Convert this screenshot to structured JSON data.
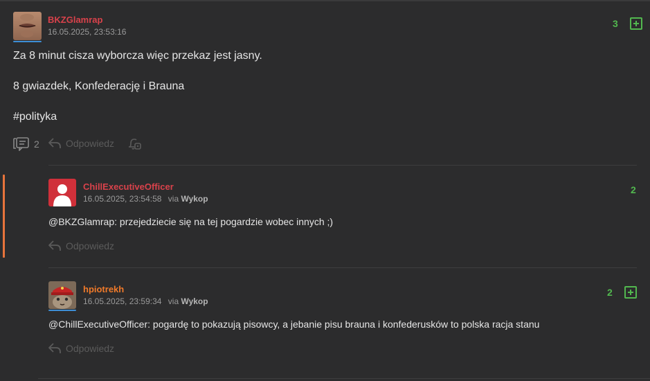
{
  "entry": {
    "author": "BKZGlamrap",
    "timestamp": "16.05.2025, 23:53:16",
    "votes": "3",
    "lines": [
      "Za 8 minut cisza wyborcza więc przekaz jest jasny.",
      "8 gwiazdek, Konfederację i Brauna",
      "#polityka"
    ],
    "comments_count": "2",
    "reply_label": "Odpowiedz"
  },
  "comments": [
    {
      "author": "ChillExecutiveOfficer",
      "timestamp": "16.05.2025, 23:54:58",
      "via_prefix": "via",
      "via_app": "Wykop",
      "votes": "2",
      "mention": "@BKZGlamrap",
      "text": ": przejedziecie się na tej pogardzie wobec innych ;)",
      "reply_label": "Odpowiedz"
    },
    {
      "author": "hpiotrekh",
      "timestamp": "16.05.2025, 23:59:34",
      "via_prefix": "via",
      "via_app": "Wykop",
      "votes": "2",
      "mention": "@ChillExecutiveOfficer",
      "text": ": pogardę to pokazują pisowcy, a jebanie pisu brauna i konfederusków to polska racja stanu",
      "reply_label": "Odpowiedz"
    }
  ],
  "colors": {
    "background": "#2c2c2d",
    "upvote_green": "#52b84f",
    "author_red": "#d9424b",
    "author_orange": "#f07a2a",
    "accent_orange": "#e8743b",
    "avatar_underline_blue": "#3e8fd6"
  },
  "icons": [
    "comments-icon",
    "reply-icon",
    "bell-icon",
    "plus-icon",
    "user-silhouette-icon"
  ]
}
